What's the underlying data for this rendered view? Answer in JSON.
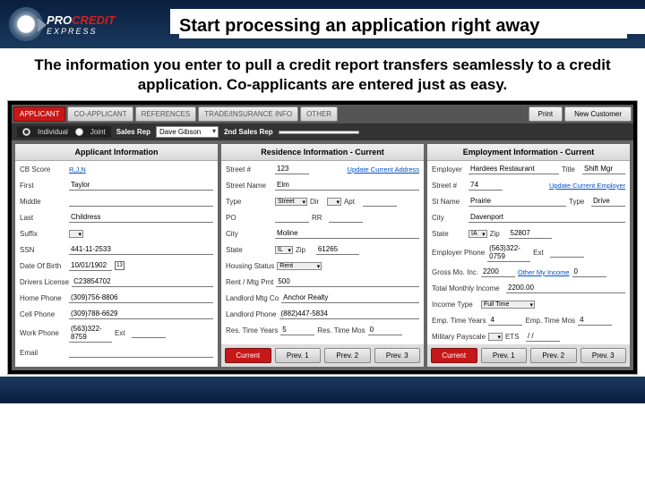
{
  "header": {
    "title": "Start processing an application right away"
  },
  "subtitle": "The information you enter to pull a credit report transfers seamlessly to a credit application.  Co-applicants are entered just as easy.",
  "tabs": {
    "applicant": "APPLICANT",
    "coapplicant": "CO-APPLICANT",
    "references": "REFERENCES",
    "trade": "TRADE/INSURANCE INFO",
    "other": "OTHER"
  },
  "topbtns": {
    "print": "Print",
    "newcustomer": "New Customer"
  },
  "row2": {
    "individual": "Individual",
    "joint": "Joint",
    "salesrep_label": "Sales Rep",
    "salesrep_value": "Dave Gibson",
    "salesrep2_label": "2nd Sales Rep",
    "salesrep2_value": ""
  },
  "col1": {
    "header": "Applicant Information",
    "cbscore_l": "CB Score",
    "cbscore_v": "R,J,N",
    "first_l": "First",
    "first_v": "Taylor",
    "middle_l": "Middle",
    "middle_v": "",
    "last_l": "Last",
    "last_v": "Childress",
    "suffix_l": "Suffix",
    "ssn_l": "SSN",
    "ssn_v": "441-11-2533",
    "dob_l": "Date Of Birth",
    "dob_v": "10/01/1902",
    "dl_l": "Drivers License",
    "dl_v": "C23854702",
    "hphone_l": "Home Phone",
    "hphone_v": "(309)756-8806",
    "cphone_l": "Cell Phone",
    "cphone_v": "(309)788-6629",
    "wphone_l": "Work Phone",
    "wphone_v": "(563)322-8759",
    "ext_l": "Ext",
    "email_l": "Email"
  },
  "col2": {
    "header": "Residence Information - Current",
    "streetnum_l": "Street #",
    "streetnum_v": "123",
    "update_addr": "Update Current Address",
    "streetname_l": "Street Name",
    "streetname_v": "Elm",
    "type_l": "Type",
    "type_v": "Street",
    "dir_l": "Dir",
    "apt_l": "Apt",
    "po_l": "PO",
    "rr_l": "RR",
    "city_l": "City",
    "city_v": "Moline",
    "state_l": "State",
    "state_v": "IL",
    "zip_l": "Zip",
    "zip_v": "61265",
    "housing_l": "Housing Status",
    "housing_v": "Rent",
    "rent_l": "Rent / Mtg Pmt",
    "rent_v": "500",
    "landlord_l": "Landlord Mtg Co",
    "landlord_v": "Anchor Realty",
    "llphone_l": "Landlord Phone",
    "llphone_v": "(882)447-5834",
    "resyrs_l": "Res. Time Years",
    "resyrs_v": "5",
    "resmos_l": "Res. Time Mos",
    "resmos_v": "0",
    "btns": {
      "current": "Current",
      "p1": "Prev. 1",
      "p2": "Prev. 2",
      "p3": "Prev. 3"
    }
  },
  "col3": {
    "header": "Employment Information - Current",
    "employer_l": "Employer",
    "employer_v": "Hardees Restaurant",
    "title_l": "Title",
    "title_v": "Shift Mgr",
    "streetnum_l": "Street #",
    "streetnum_v": "74",
    "update_emp": "Update Current Employer",
    "stname_l": "St Name",
    "stname_v": "Prairie",
    "type_l": "Type",
    "type_v": "Drive",
    "city_l": "City",
    "city_v": "Davenport",
    "state_l": "State",
    "state_v": "IA",
    "zip_l": "Zip",
    "zip_v": "52807",
    "ephone_l": "Employer Phone",
    "ephone_v": "(563)322-0759",
    "ext_l": "Ext",
    "gross_l": "Gross Mo. Inc.",
    "gross_v": "2200",
    "other_l": "Other My Income",
    "other_v": "0",
    "total_l": "Total Monthly Income",
    "total_v": "2200.00",
    "inctype_l": "Income Type",
    "inctype_v": "Full Time",
    "empyrs_l": "Emp. Time Years",
    "empyrs_v": "4",
    "empmos_l": "Emp. Time Mos",
    "empmos_v": "4",
    "mil_l": "Military Payscale",
    "ets_l": "ETS",
    "ets_v": "/  /",
    "btns": {
      "current": "Current",
      "p1": "Prev. 1",
      "p2": "Prev. 2",
      "p3": "Prev. 3"
    }
  }
}
